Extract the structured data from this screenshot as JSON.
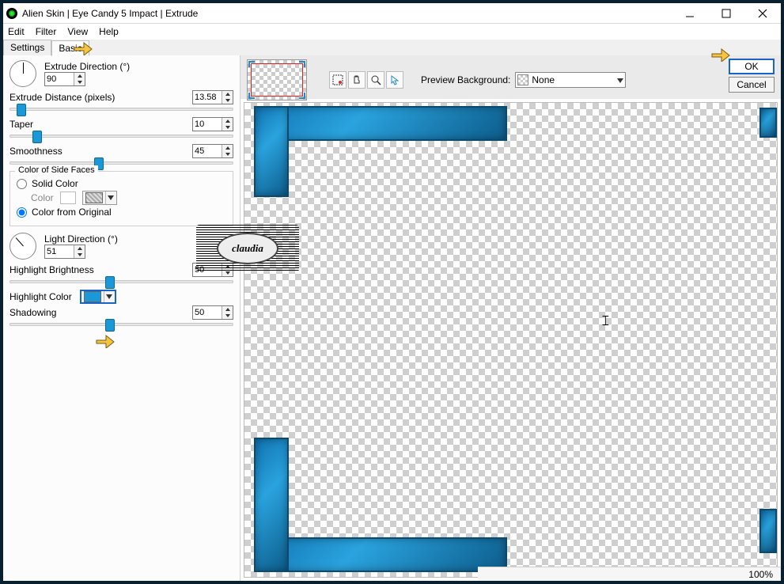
{
  "window": {
    "title": "Alien Skin | Eye Candy 5 Impact | Extrude"
  },
  "menu": {
    "edit": "Edit",
    "filter": "Filter",
    "view": "View",
    "help": "Help"
  },
  "tabs": {
    "settings": "Settings",
    "basic": "Basic"
  },
  "controls": {
    "extrude_direction": {
      "label": "Extrude Direction (°)",
      "value": "90"
    },
    "extrude_distance": {
      "label": "Extrude Distance (pixels)",
      "value": "13.58",
      "slider_pct": 5
    },
    "taper": {
      "label": "Taper",
      "value": "10",
      "slider_pct": 12
    },
    "smoothness": {
      "label": "Smoothness",
      "value": "45",
      "slider_pct": 40
    },
    "side_faces": {
      "legend": "Color of Side Faces",
      "solid": "Solid Color",
      "color_label": "Color",
      "from_original": "Color from Original"
    },
    "light_direction": {
      "label": "Light Direction (°)",
      "value": "51"
    },
    "highlight_brightness": {
      "label": "Highlight Brightness",
      "value": "50",
      "slider_pct": 45
    },
    "highlight_color": {
      "label": "Highlight Color"
    },
    "shadowing": {
      "label": "Shadowing",
      "value": "50",
      "slider_pct": 45
    }
  },
  "preview": {
    "bg_label": "Preview Background:",
    "bg_value": "None"
  },
  "buttons": {
    "ok": "OK",
    "cancel": "Cancel"
  },
  "status": {
    "zoom": "100%"
  },
  "watermark": {
    "text": "claudia"
  }
}
